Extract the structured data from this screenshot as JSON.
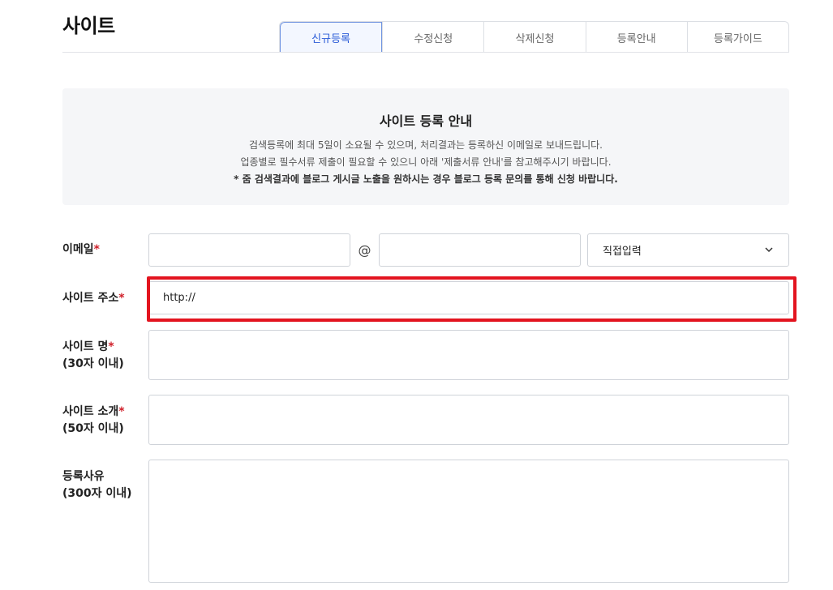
{
  "page": {
    "title": "사이트"
  },
  "tabs": [
    {
      "label": "신규등록",
      "active": true
    },
    {
      "label": "수정신청",
      "active": false
    },
    {
      "label": "삭제신청",
      "active": false
    },
    {
      "label": "등록안내",
      "active": false
    },
    {
      "label": "등록가이드",
      "active": false
    }
  ],
  "notice": {
    "title": "사이트 등록 안내",
    "lines": [
      "검색등록에 최대 5일이 소요될 수 있으며, 처리결과는 등록하신 이메일로 보내드립니다.",
      "업종별로 필수서류 제출이 필요할 수 있으니 아래 '제출서류 안내'를 참고해주시기 바랍니다.",
      "* 줌 검색결과에 블로그 게시글 노출을 원하시는 경우 블로그 등록 문의를 통해 신청 바랍니다."
    ]
  },
  "form": {
    "required_mark": "*",
    "email": {
      "label": "이메일",
      "local_value": "",
      "domain_value": "",
      "at_symbol": "@",
      "domain_select": "직접입력"
    },
    "site_url": {
      "label": "사이트 주소",
      "value": "http://"
    },
    "site_name": {
      "label_line1": "사이트 명",
      "label_line2": "(30자 이내)",
      "value": ""
    },
    "site_intro": {
      "label_line1": "사이트 소개",
      "label_line2": "(50자 이내)",
      "value": ""
    },
    "reason": {
      "label_line1": "등록사유",
      "label_line2": "(300자 이내)",
      "value": ""
    }
  },
  "colors": {
    "accent": "#2a5bd7",
    "required": "#d0202a",
    "highlight": "#e3141f"
  }
}
